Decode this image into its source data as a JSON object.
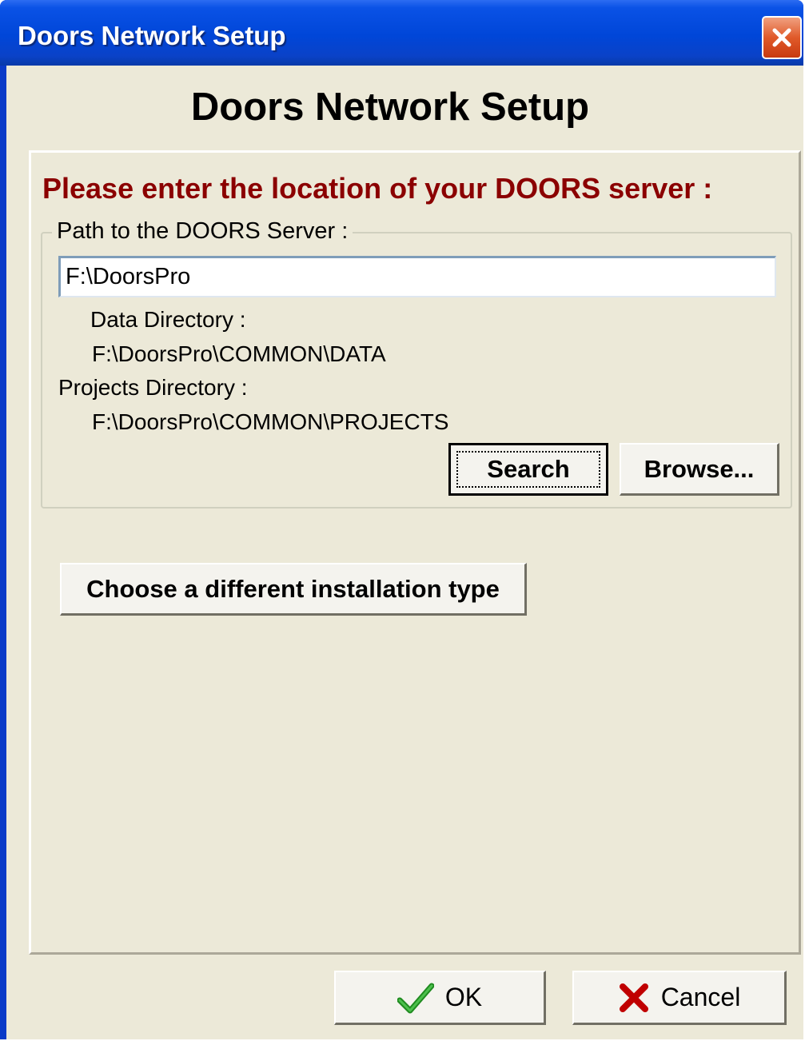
{
  "window": {
    "title": "Doors Network Setup"
  },
  "dialog": {
    "heading": "Doors Network Setup",
    "prompt": "Please enter the location of your DOORS server :",
    "group_label": "Path to the DOORS Server  :",
    "path_value": "F:\\DoorsPro",
    "data_dir_label": "Data Directory :",
    "data_dir_value": "F:\\DoorsPro\\COMMON\\DATA",
    "projects_dir_label": "Projects Directory :",
    "projects_dir_value": "F:\\DoorsPro\\COMMON\\PROJECTS",
    "search_label": "Search",
    "browse_label": "Browse...",
    "install_type_label": "Choose a different installation type",
    "ok_label": "OK",
    "cancel_label": "Cancel"
  },
  "icons": {
    "close": "close-icon",
    "ok": "checkmark-icon",
    "cancel": "cross-icon"
  },
  "colors": {
    "titlebar": "#0046d8",
    "prompt": "#8b0000",
    "dialog_bg": "#ece9d8",
    "close_button": "#e05a2a",
    "checkmark": "#1f8a1f",
    "cross": "#c00000"
  }
}
